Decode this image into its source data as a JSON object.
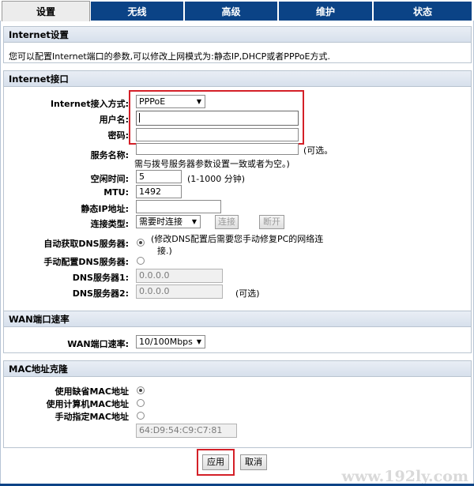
{
  "tabs": [
    "设置",
    "无线",
    "高级",
    "维护",
    "状态"
  ],
  "internet_settings": {
    "title": "Internet设置",
    "description": "您可以配置Internet端口的参数,可以修改上网模式为:静态IP,DHCP或者PPPoE方式."
  },
  "internet_port": {
    "title": "Internet接口",
    "access_mode_label": "Internet接入方式:",
    "access_mode_value": "PPPoE",
    "username_label": "用户名:",
    "username_value": "",
    "password_label": "密码:",
    "password_value": "",
    "service_name_label": "服务名称:",
    "service_name_value": "",
    "service_name_hint": "(可选。",
    "service_name_hint2": "需与拨号服务器参数设置一致或者为空。)",
    "idle_time_label": "空闲时间:",
    "idle_time_value": "5",
    "idle_time_hint": "(1-1000 分钟)",
    "mtu_label": "MTU:",
    "mtu_value": "1492",
    "static_ip_label": "静态IP地址:",
    "static_ip_value": "",
    "connection_type_label": "连接类型:",
    "connection_type_value": "需要时连接",
    "connect_button": "连接",
    "disconnect_button": "断开",
    "auto_dns_label": "自动获取DNS服务器:",
    "auto_dns_hint": "(修改DNS配置后需要您手动修复PC的网络连",
    "auto_dns_hint2": "接.)",
    "manual_dns_label": "手动配置DNS服务器:",
    "dns1_label": "DNS服务器1:",
    "dns1_value": "0.0.0.0",
    "dns2_label": "DNS服务器2:",
    "dns2_value": "0.0.0.0",
    "dns2_hint": "(可选)"
  },
  "wan_speed": {
    "title": "WAN端口速率",
    "label": "WAN端口速率:",
    "value": "10/100Mbps"
  },
  "mac_clone": {
    "title": "MAC地址克隆",
    "default_mac_label": "使用缺省MAC地址",
    "pc_mac_label": "使用计算机MAC地址",
    "manual_mac_label": "手动指定MAC地址",
    "mac_value": "64:D9:54:C9:C7:81"
  },
  "actions": {
    "apply": "应用",
    "cancel": "取消"
  },
  "watermark": "www.192ly.com",
  "colors": {
    "tab_bg": "#0b4386",
    "highlight": "#d42028",
    "section_header": "#dfe6ef"
  }
}
